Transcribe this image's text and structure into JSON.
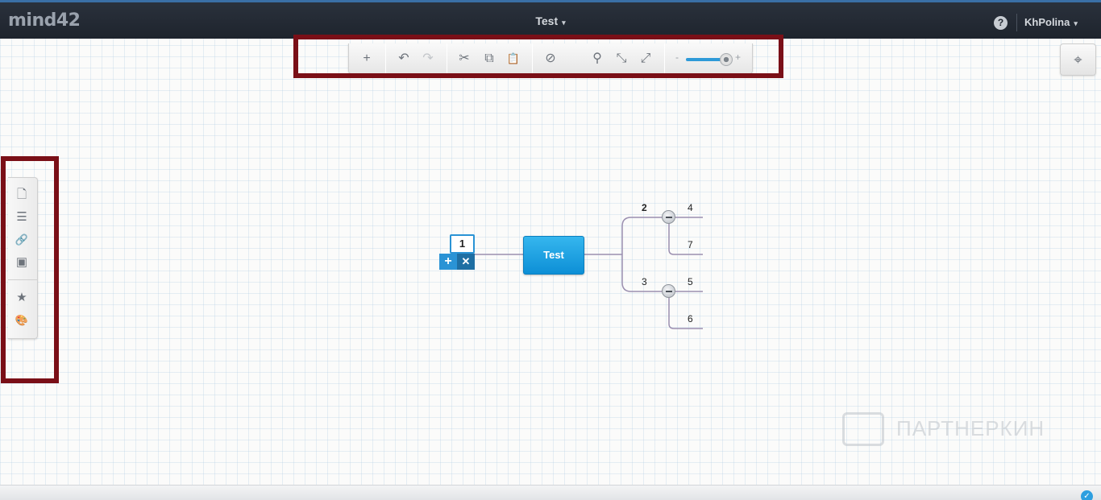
{
  "header": {
    "logo": "mind42",
    "document_title": "Test",
    "help_icon": "question-circle-icon",
    "help_glyph": "?",
    "user_name": "KhPolina",
    "caret": "▾"
  },
  "toolbar": {
    "buttons": [
      {
        "name": "add-node",
        "icon": "plus-icon",
        "glyph": "+",
        "enabled": true
      },
      {
        "name": "undo",
        "icon": "undo-icon",
        "glyph": "↶",
        "enabled": true
      },
      {
        "name": "redo",
        "icon": "redo-icon",
        "glyph": "↷",
        "enabled": false
      },
      {
        "name": "cut",
        "icon": "scissors-icon",
        "glyph": "✂",
        "enabled": true
      },
      {
        "name": "copy",
        "icon": "copy-icon",
        "glyph": "⧉",
        "enabled": true
      },
      {
        "name": "paste",
        "icon": "paste-icon",
        "glyph": "📋",
        "enabled": false
      },
      {
        "name": "delete",
        "icon": "no-entry-icon",
        "glyph": "⊘",
        "enabled": true
      },
      {
        "name": "search",
        "icon": "magnifier-icon",
        "glyph": "⚲",
        "enabled": true
      },
      {
        "name": "collapse-all",
        "icon": "collapse-arrows-icon",
        "glyph": "⤡",
        "enabled": true
      },
      {
        "name": "expand-all",
        "icon": "expand-arrows-icon",
        "glyph": "⤢",
        "enabled": true
      }
    ],
    "zoom_minus": "-",
    "zoom_plus": "+",
    "zoom_level": 0.85
  },
  "sidebar": {
    "items": [
      {
        "name": "notes",
        "icon": "document-icon",
        "glyph": "🗋"
      },
      {
        "name": "list",
        "icon": "list-icon",
        "glyph": "☰"
      },
      {
        "name": "link",
        "icon": "link-icon",
        "glyph": "🔗"
      },
      {
        "name": "image",
        "icon": "image-icon",
        "glyph": "▣"
      },
      {
        "name": "favorite",
        "icon": "star-icon",
        "glyph": "★"
      },
      {
        "name": "theme",
        "icon": "palette-icon",
        "glyph": "🎨"
      }
    ]
  },
  "locate_button": {
    "icon": "crosshair-icon",
    "glyph": "⌖"
  },
  "mindmap": {
    "root": "Test",
    "editing_node": "1",
    "add_glyph": "+",
    "delete_glyph": "✕",
    "nodes": [
      {
        "id": "n2",
        "label": "2",
        "bold": true
      },
      {
        "id": "n3",
        "label": "3",
        "bold": false
      },
      {
        "id": "n4",
        "label": "4",
        "bold": false
      },
      {
        "id": "n7",
        "label": "7",
        "bold": false
      },
      {
        "id": "n5",
        "label": "5",
        "bold": false
      },
      {
        "id": "n6",
        "label": "6",
        "bold": false
      }
    ]
  },
  "watermark": "ПАРТНЕРКИН",
  "status": {
    "icon": "check-circle-icon",
    "glyph": "✓"
  },
  "colors": {
    "accent": "#2a93d5",
    "root_node": "#1ba3e6",
    "highlight_frame": "#7a0f17",
    "topbar": "#232a33"
  }
}
